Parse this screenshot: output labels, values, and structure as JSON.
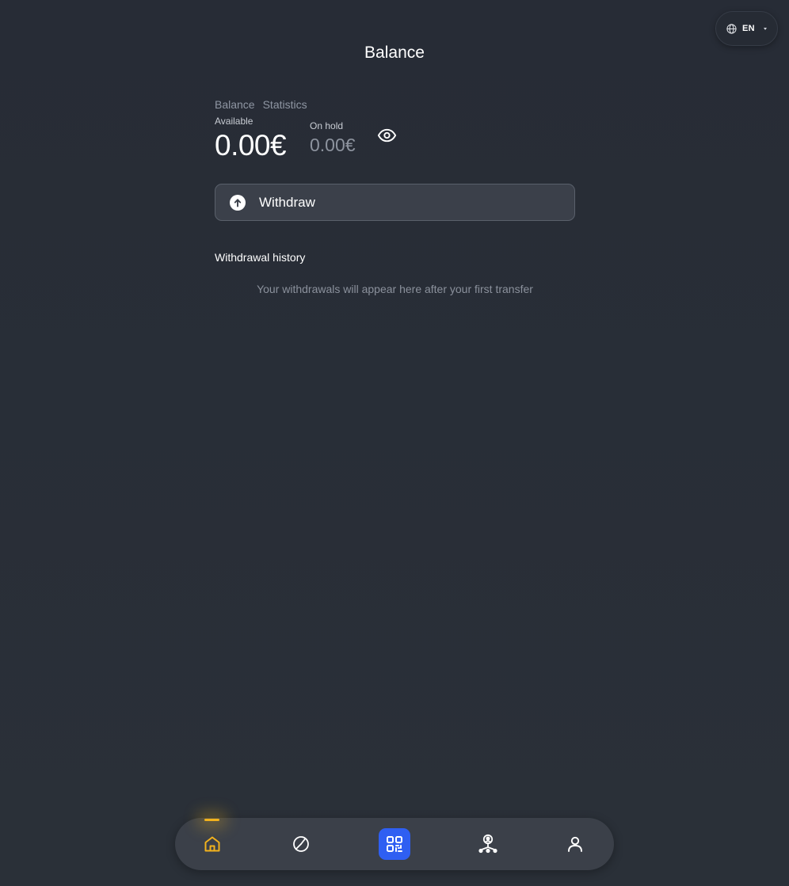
{
  "language": {
    "code": "EN",
    "icon": "globe-icon"
  },
  "header": {
    "title": "Balance"
  },
  "tabs": [
    {
      "label": "Balance"
    },
    {
      "label": "Statistics"
    }
  ],
  "balance": {
    "available_label": "Available",
    "available_amount": "0.00€",
    "on_hold_label": "On hold",
    "on_hold_amount": "0.00€",
    "visibility_icon": "eye-icon"
  },
  "withdraw": {
    "label": "Withdraw",
    "icon": "arrow-up-circle-icon"
  },
  "history": {
    "title": "Withdrawal history",
    "empty_text": "Your withdrawals will appear here after your first transfer"
  },
  "bottom_nav": {
    "active": "home",
    "accent_color": "#f2b21d",
    "scan_color": "#2f5ff2",
    "items": [
      {
        "name": "home",
        "icon": "home-icon"
      },
      {
        "name": "statistics",
        "icon": "pie-chart-icon"
      },
      {
        "name": "scan",
        "icon": "qr-code-icon"
      },
      {
        "name": "team",
        "icon": "team-network-icon"
      },
      {
        "name": "profile",
        "icon": "user-icon"
      }
    ]
  }
}
